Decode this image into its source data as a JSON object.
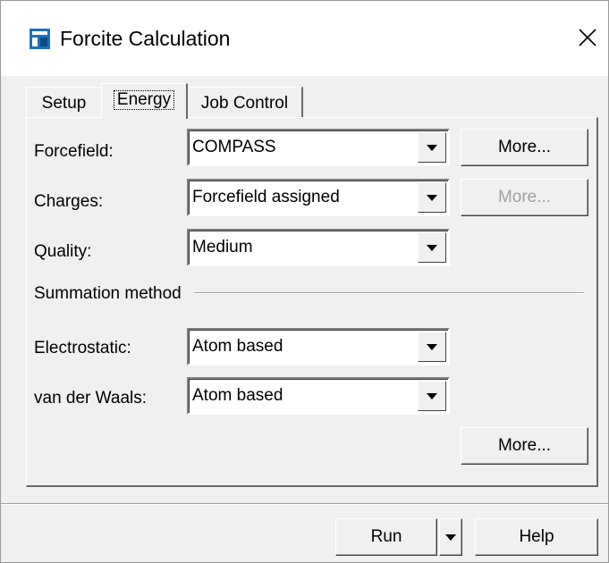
{
  "window": {
    "title": "Forcite Calculation"
  },
  "tabs": [
    {
      "label": "Setup"
    },
    {
      "label": "Energy"
    },
    {
      "label": "Job Control"
    }
  ],
  "energy": {
    "forcefield": {
      "label": "Forcefield:",
      "value": "COMPASS",
      "more_label": "More..."
    },
    "charges": {
      "label": "Charges:",
      "value": "Forcefield assigned",
      "more_label": "More..."
    },
    "quality": {
      "label": "Quality:",
      "value": "Medium"
    },
    "summation_heading": "Summation method",
    "electrostatic": {
      "label": "Electrostatic:",
      "value": "Atom based"
    },
    "vdw": {
      "label": "van der Waals:",
      "value": "Atom based"
    },
    "summation_more_label": "More..."
  },
  "footer": {
    "run_label": "Run",
    "help_label": "Help"
  },
  "colors": {
    "icon_blue": "#1e6fb8",
    "dialog_bg": "#f0f0f0"
  }
}
